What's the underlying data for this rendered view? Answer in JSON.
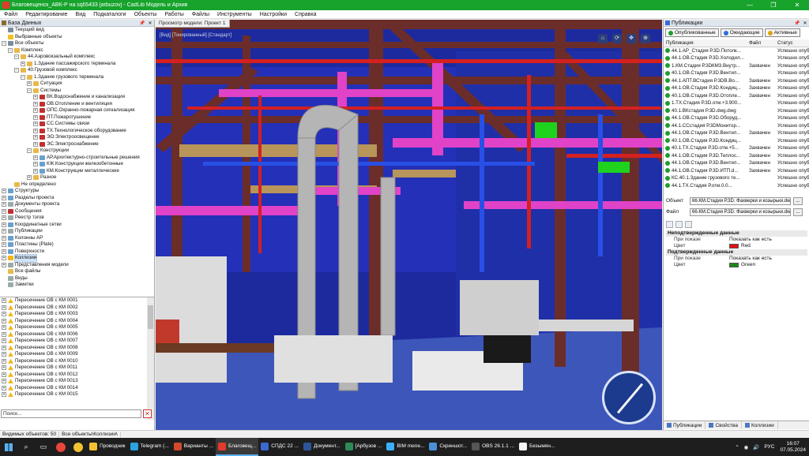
{
  "window": {
    "title": "Благовещенск_АВК-Р на sql\\5433 [arbuzov] - CadLib Модель и Архив",
    "controls": [
      "—",
      "❐",
      "✕"
    ]
  },
  "menu": [
    "Файл",
    "Редактирование",
    "Вид",
    "Подкаталоги",
    "Объекты",
    "Работы",
    "Файлы",
    "Инструменты",
    "Настройки",
    "Справка"
  ],
  "left_panel": {
    "title": "База Данных",
    "tree": [
      {
        "label": "Текущий вид",
        "level": 0,
        "exp": "",
        "icon": "db"
      },
      {
        "label": "Выбранные объекты",
        "level": 0,
        "exp": "",
        "icon": "star"
      },
      {
        "label": "Все объекты",
        "level": 0,
        "exp": "−",
        "icon": "db"
      },
      {
        "label": "Комплекс",
        "level": 1,
        "exp": "−",
        "icon": "folder"
      },
      {
        "label": "44.Аэровокзальный комплекс",
        "level": 2,
        "exp": "−",
        "icon": "folder"
      },
      {
        "label": "1.Здание пассажирского терминала",
        "level": 3,
        "exp": "+",
        "icon": "folder"
      },
      {
        "label": "40.Грузовой комплекс",
        "level": 2,
        "exp": "−",
        "icon": "folder"
      },
      {
        "label": "1.Здание грузового терминала",
        "level": 3,
        "exp": "−",
        "icon": "folder"
      },
      {
        "label": "Ситуация",
        "level": 4,
        "exp": "+",
        "icon": "folder"
      },
      {
        "label": "Системы",
        "level": 4,
        "exp": "−",
        "icon": "folder"
      },
      {
        "label": "ВК.Водоснабжение и канализация",
        "level": 5,
        "exp": "+",
        "icon": "sys"
      },
      {
        "label": "ОВ.Отопление и вентиляция",
        "level": 5,
        "exp": "+",
        "icon": "sys"
      },
      {
        "label": "ОПС.Охранно-пожарная сигнализация",
        "level": 5,
        "exp": "+",
        "icon": "sys"
      },
      {
        "label": "ПТ.Пожаротушение",
        "level": 5,
        "exp": "+",
        "icon": "sys"
      },
      {
        "label": "СС.Системы связи",
        "level": 5,
        "exp": "+",
        "icon": "sys"
      },
      {
        "label": "ТХ.Технологическое оборудование",
        "level": 5,
        "exp": "+",
        "icon": "sys"
      },
      {
        "label": "ЭО.Электроосвещение",
        "level": 5,
        "exp": "+",
        "icon": "sys"
      },
      {
        "label": "ЭС.Электроснабжение",
        "level": 5,
        "exp": "+",
        "icon": "sys"
      },
      {
        "label": "Конструкции",
        "level": 4,
        "exp": "−",
        "icon": "folder"
      },
      {
        "label": "АР.Архитектурно-строительные решения",
        "level": 5,
        "exp": "+",
        "icon": "grid"
      },
      {
        "label": "КЖ.Конструкции железобетонные",
        "level": 5,
        "exp": "+",
        "icon": "grid"
      },
      {
        "label": "КМ.Конструкции металлические",
        "level": 5,
        "exp": "+",
        "icon": "grid"
      },
      {
        "label": "Разное",
        "level": 4,
        "exp": "+",
        "icon": "folder"
      },
      {
        "label": "Не определено",
        "level": 1,
        "exp": "",
        "icon": "folder"
      },
      {
        "label": "Структуры",
        "level": 0,
        "exp": "+",
        "icon": "grid"
      },
      {
        "label": "Разделы проекта",
        "level": 0,
        "exp": "+",
        "icon": "grid"
      },
      {
        "label": "Документы проекта",
        "level": 0,
        "exp": "+",
        "icon": "doc"
      },
      {
        "label": "Сообщения",
        "level": 0,
        "exp": "+",
        "icon": "sys"
      },
      {
        "label": "Реестр тэгов",
        "level": 0,
        "exp": "+",
        "icon": "doc"
      },
      {
        "label": "Координатные сетки",
        "level": 0,
        "exp": "+",
        "icon": "grid"
      },
      {
        "label": "Публикации",
        "level": 0,
        "exp": "+",
        "icon": "doc"
      },
      {
        "label": "Колонны АР",
        "level": 0,
        "exp": "+",
        "icon": "grid"
      },
      {
        "label": "Пластины (Plate)",
        "level": 0,
        "exp": "+",
        "icon": "grid"
      },
      {
        "label": "Поверхности",
        "level": 0,
        "exp": "+",
        "icon": "grid"
      },
      {
        "label": "Коллизии",
        "level": 0,
        "exp": "+",
        "icon": "warn",
        "selected": true
      },
      {
        "label": "Представления модели",
        "level": 0,
        "exp": "+",
        "icon": "doc"
      },
      {
        "label": "Все файлы",
        "level": 0,
        "exp": "",
        "icon": "folder"
      },
      {
        "label": "Виды",
        "level": 0,
        "exp": "",
        "icon": "doc"
      },
      {
        "label": "Заметки",
        "level": 0,
        "exp": "",
        "icon": "doc"
      }
    ],
    "collisions": [
      "Пересечение ОВ с КМ 0001",
      "Пересечение ОВ с КМ 0002",
      "Пересечение ОВ с КМ 0003",
      "Пересечение ОВ с КМ 0004",
      "Пересечение ОВ с КМ 0005",
      "Пересечение ОВ с КМ 0006",
      "Пересечение ОВ с КМ 0007",
      "Пересечение ОВ с КМ 0008",
      "Пересечение ОВ с КМ 0009",
      "Пересечение ОВ с КМ 0010",
      "Пересечение ОВ с КМ 0011",
      "Пересечение ОВ с КМ 0012",
      "Пересечение ОВ с КМ 0013",
      "Пересечение ОВ с КМ 0014",
      "Пересечение ОВ с КМ 0015"
    ],
    "search_placeholder": "Поиск...",
    "search_clear": "✕"
  },
  "status": {
    "visible": "Видимых объектов: 50",
    "path": "Все объекты\\Коллизии\\"
  },
  "viewport": {
    "tab": "Просмотр модели: Проект 1",
    "caption": "[Вид] [Тонированный] [Стандарт]"
  },
  "right_panel": {
    "title": "Публикации",
    "tabs": [
      {
        "label": "Опубликованные",
        "color": "#1e9c2e"
      },
      {
        "label": "Ожидающие",
        "color": "#2f6fd0"
      },
      {
        "label": "Активные",
        "color": "#e0a010"
      }
    ],
    "columns": [
      "Публикация",
      "Файл",
      "Статус"
    ],
    "rows": [
      {
        "pub": "44.1.АР_Стадия Р.3D.Потолк...",
        "file": "",
        "status": "Успешно опубл"
      },
      {
        "pub": "44.1.ОВ.Стадия Р.3D.Холодил...",
        "file": "",
        "status": "Успешно опубл"
      },
      {
        "pub": "1.КМ.Стадия Р.3DКМ3.Внутр...",
        "file": "Захвачен",
        "status": "Успешно опубл"
      },
      {
        "pub": "40.1.ОВ.Стадия Р.3D.Вентил...",
        "file": "",
        "status": "Успешно опубл"
      },
      {
        "pub": "44.1.АПТ.ВСтадия Р.3DВ.Во...",
        "file": "Захвачен",
        "status": "Успешно опубл"
      },
      {
        "pub": "44.1.ОВ.Стадия Р.3D.Кондиц...",
        "file": "Захвачен",
        "status": "Успешно опубл"
      },
      {
        "pub": "40.1.ОВ.Стадия Р.3D.Отопле...",
        "file": "Захвачен",
        "status": "Успешно опубл"
      },
      {
        "pub": "1.ТХ.Стадия Р.3D.отм.+3.900...",
        "file": "",
        "status": "Успешно опубл"
      },
      {
        "pub": "40.1.ВКстадия Р.3D.dwg.dwg",
        "file": "",
        "status": "Успешно опубл"
      },
      {
        "pub": "44.1.ОВ.Стадия Р.3D.Оборуд...",
        "file": "",
        "status": "Успешно опубл"
      },
      {
        "pub": "44.1.ССстадия Р.3DМонитор...",
        "file": "",
        "status": "Успешно опубл"
      },
      {
        "pub": "44.1.ОВ.Стадия Р.3D.Вентил...",
        "file": "Захвачен",
        "status": "Успешно опубл"
      },
      {
        "pub": "40.1.ОВ.Стадия Р.3D.Кондиц...",
        "file": "",
        "status": "Успешно опубл"
      },
      {
        "pub": "40.1.ТХ.Стадия Р.3D.отм.+5...",
        "file": "Захвачен",
        "status": "Успешно опубл"
      },
      {
        "pub": "44.1.ОВ.Стадия Р.3D.Теплос...",
        "file": "Захвачен",
        "status": "Успешно опубл"
      },
      {
        "pub": "44.1.ОВ.Стадия Р.3D.Вентил...",
        "file": "Захвачен",
        "status": "Успешно опубл"
      },
      {
        "pub": "44.1.ОВ.Стадия Р.3D.ИТП.d...",
        "file": "Захвачен",
        "status": "Успешно опубл"
      },
      {
        "pub": "КС.40.1.Здание грузового те...",
        "file": "",
        "status": "Успешно опубл"
      },
      {
        "pub": "44.1.ТХ.Стадия Р.отм.0.0...",
        "file": "",
        "status": "Успешно опубл"
      }
    ],
    "object_label": "Объект",
    "object_value": "66.КМ.Стадия Р.3D. Фахверки и козырьки.dw",
    "file_label": "Файл",
    "file_value": "66.КМ.Стадия Р.3D. Фахверки и козырьки.dw",
    "browse": "...",
    "propgrid": {
      "cat1": "Неподтвержденные данные",
      "cat1_show_key": "При показе",
      "cat1_show_val": "Показать как есть",
      "cat1_color_key": "Цвет",
      "cat1_color_val": "Red",
      "cat1_color_hex": "#e01010",
      "cat2": "Подтвержденные данные",
      "cat2_show_key": "При показе",
      "cat2_show_val": "Показать как есть",
      "cat2_color_key": "Цвет",
      "cat2_color_val": "Green",
      "cat2_color_hex": "#1a8a1a"
    },
    "bottom_tabs": [
      "Публикации",
      "Свойства",
      "Коллизии"
    ]
  },
  "taskbar": {
    "apps": [
      {
        "label": "Проводник",
        "color": "#f2c230",
        "active": false
      },
      {
        "label": "Telegram (...",
        "color": "#2aa3e0",
        "active": false
      },
      {
        "label": "Варианты ...",
        "color": "#d24a2b",
        "active": false
      },
      {
        "label": "Благовещ...",
        "color": "#e23b2b",
        "active": true
      },
      {
        "label": "СПДС 22 ...",
        "color": "#3a6ad0",
        "active": false
      },
      {
        "label": "Документ...",
        "color": "#2b579a",
        "active": false
      },
      {
        "label": "[Арбузов ...",
        "color": "#2e8b57",
        "active": false
      },
      {
        "label": "BIM mene...",
        "color": "#3ab0ff",
        "active": false
      },
      {
        "label": "Скриншот...",
        "color": "#4a90d9",
        "active": false
      },
      {
        "label": "OBS 26.1.1 ...",
        "color": "#555555",
        "active": false
      },
      {
        "label": "Безымян...",
        "color": "#f5f5f5",
        "active": false
      }
    ],
    "lang": "РУС",
    "time": "16:07",
    "date": "07.05.2024"
  }
}
